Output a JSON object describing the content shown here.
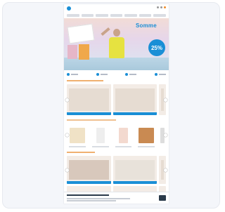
{
  "hero": {
    "title": "Somme",
    "badge": "25%"
  },
  "colors": {
    "accent": "#1a8fd6",
    "orange": "#f08c2a",
    "background": "#f4f6fa"
  },
  "icons": [
    "logo-icon",
    "user-icon",
    "cart-icon",
    "search-icon"
  ]
}
